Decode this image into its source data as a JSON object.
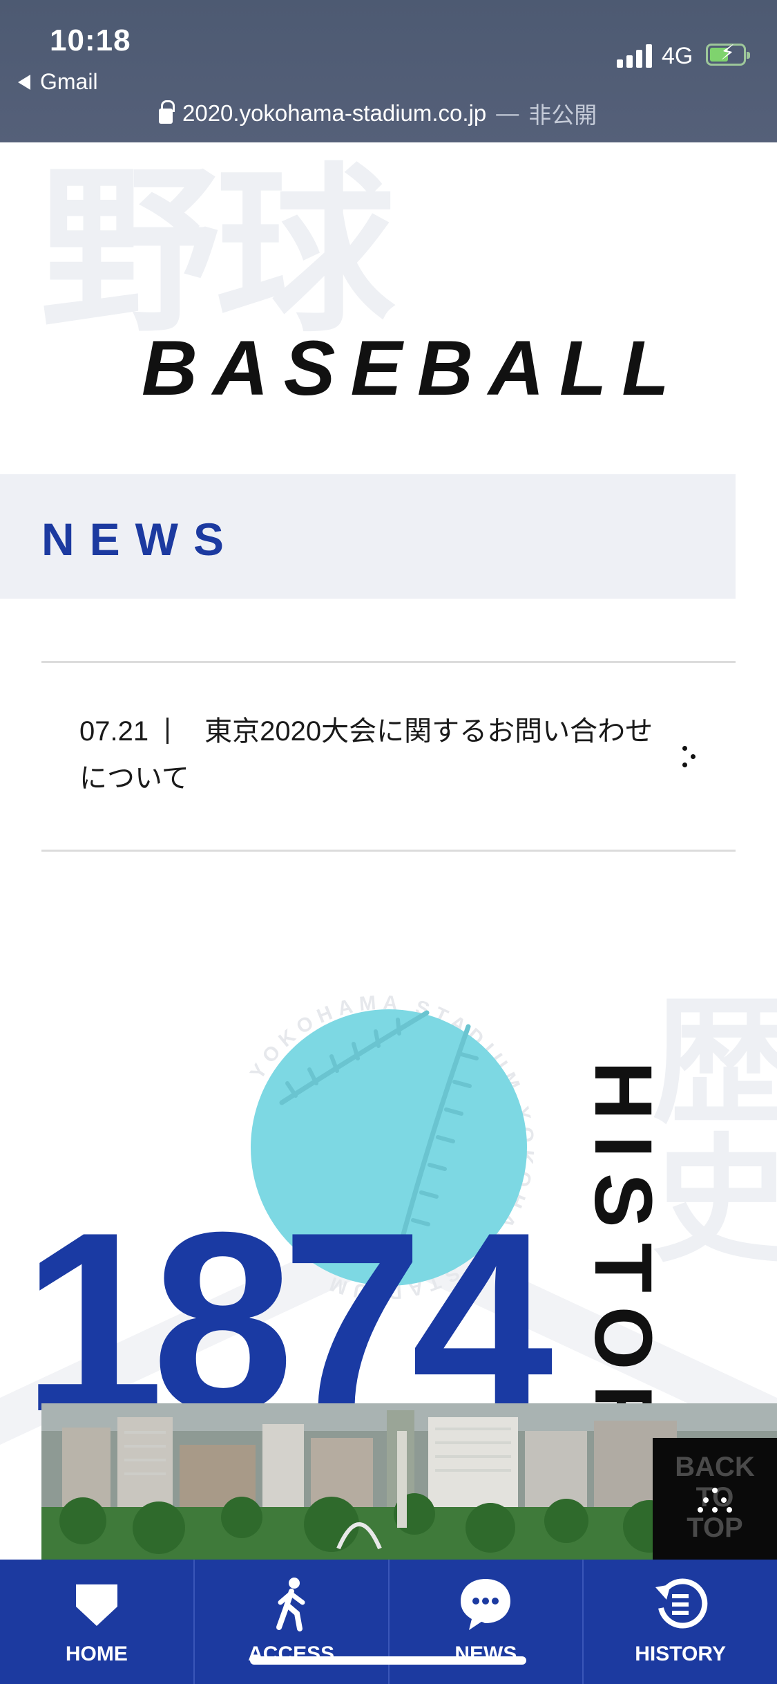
{
  "status_bar": {
    "time": "10:18",
    "back_app": "Gmail",
    "network": "4G",
    "url": "2020.yokohama-stadium.co.jp",
    "url_separator": "—",
    "privacy": "非公開"
  },
  "hero": {
    "bg_kanji": "野球",
    "title": "BASEBALL"
  },
  "news": {
    "title": "NEWS",
    "items": [
      {
        "date": "07.21",
        "text": "東京2020大会に関するお問い合わせについて"
      }
    ]
  },
  "history": {
    "bg_kanji": "歴史",
    "badge_text": "YOKOHAMA STADIUM YOKOHAMA STADIUM",
    "vertical_title": "HISTORY",
    "year": "1874"
  },
  "back_to_top": {
    "line1": "BACK",
    "line2": "TO",
    "line3": "TOP"
  },
  "bottom_nav": {
    "items": [
      {
        "label": "HOME",
        "icon": "home-base-icon"
      },
      {
        "label": "ACCESS",
        "icon": "walking-person-icon"
      },
      {
        "label": "NEWS",
        "icon": "chat-bubble-icon"
      },
      {
        "label": "HISTORY",
        "icon": "history-clock-icon"
      }
    ]
  },
  "colors": {
    "brand_blue": "#1c3aa0",
    "ball_cyan": "#7dd8e3",
    "status_bar": "#4d5a72"
  }
}
